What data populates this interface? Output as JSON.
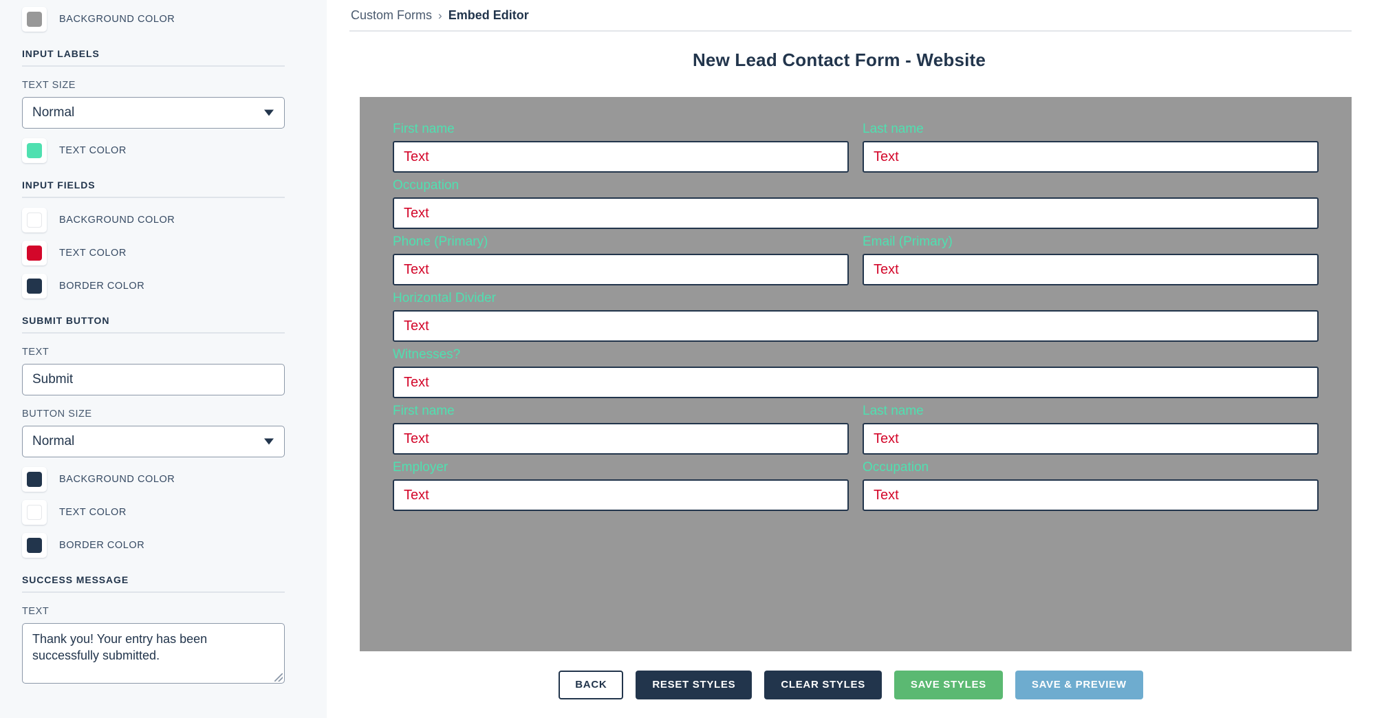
{
  "sidebar": {
    "top_swatch": {
      "label": "BACKGROUND COLOR",
      "color": "#989898"
    },
    "sections": [
      {
        "title": "INPUT LABELS",
        "text_size_label": "TEXT SIZE",
        "text_size_value": "Normal",
        "text_color_label": "TEXT COLOR",
        "text_color": "#4fe0b0"
      },
      {
        "title": "INPUT FIELDS",
        "background_label": "BACKGROUND COLOR",
        "background_color": "#ffffff",
        "text_color_label": "TEXT COLOR",
        "text_color": "#d3072a",
        "border_label": "BORDER COLOR",
        "border_color": "#22354c"
      },
      {
        "title": "SUBMIT BUTTON",
        "text_label": "TEXT",
        "text_value": "Submit",
        "button_size_label": "BUTTON SIZE",
        "button_size_value": "Normal",
        "background_label": "BACKGROUND COLOR",
        "background_color": "#22354c",
        "text_color_label": "TEXT COLOR",
        "text_color": "#ffffff",
        "border_label": "BORDER COLOR",
        "border_color": "#22354c"
      },
      {
        "title": "SUCCESS MESSAGE",
        "text_label": "TEXT",
        "text_value": "Thank you! Your entry has been successfully submitted."
      }
    ]
  },
  "breadcrumb": {
    "parent": "Custom Forms",
    "separator": "›",
    "current": "Embed Editor"
  },
  "main": {
    "form_title": "New Lead Contact Form - Website",
    "preview_background": "#989898",
    "label_color": "#4fe0b0",
    "input_text_color": "#d3072a",
    "input_border_color": "#22354c",
    "input_background_color": "#ffffff",
    "field_value": "Text",
    "rows": [
      {
        "fields": [
          {
            "label": "First name"
          },
          {
            "label": "Last name"
          }
        ]
      },
      {
        "fields": [
          {
            "label": "Occupation"
          }
        ]
      },
      {
        "fields": [
          {
            "label": "Phone (Primary)"
          },
          {
            "label": "Email (Primary)"
          }
        ]
      },
      {
        "fields": [
          {
            "label": "Horizontal Divider"
          }
        ]
      },
      {
        "fields": [
          {
            "label": "Witnesses?"
          }
        ]
      },
      {
        "fields": [
          {
            "label": "First name"
          },
          {
            "label": "Last name"
          }
        ]
      },
      {
        "fields": [
          {
            "label": "Employer"
          },
          {
            "label": "Occupation"
          }
        ]
      }
    ]
  },
  "footer": {
    "buttons": [
      {
        "label": "BACK",
        "style": "btn-back"
      },
      {
        "label": "RESET STYLES",
        "style": "btn-navy"
      },
      {
        "label": "CLEAR STYLES",
        "style": "btn-navy"
      },
      {
        "label": "SAVE STYLES",
        "style": "btn-green"
      },
      {
        "label": "SAVE & PREVIEW",
        "style": "btn-blue"
      }
    ]
  }
}
